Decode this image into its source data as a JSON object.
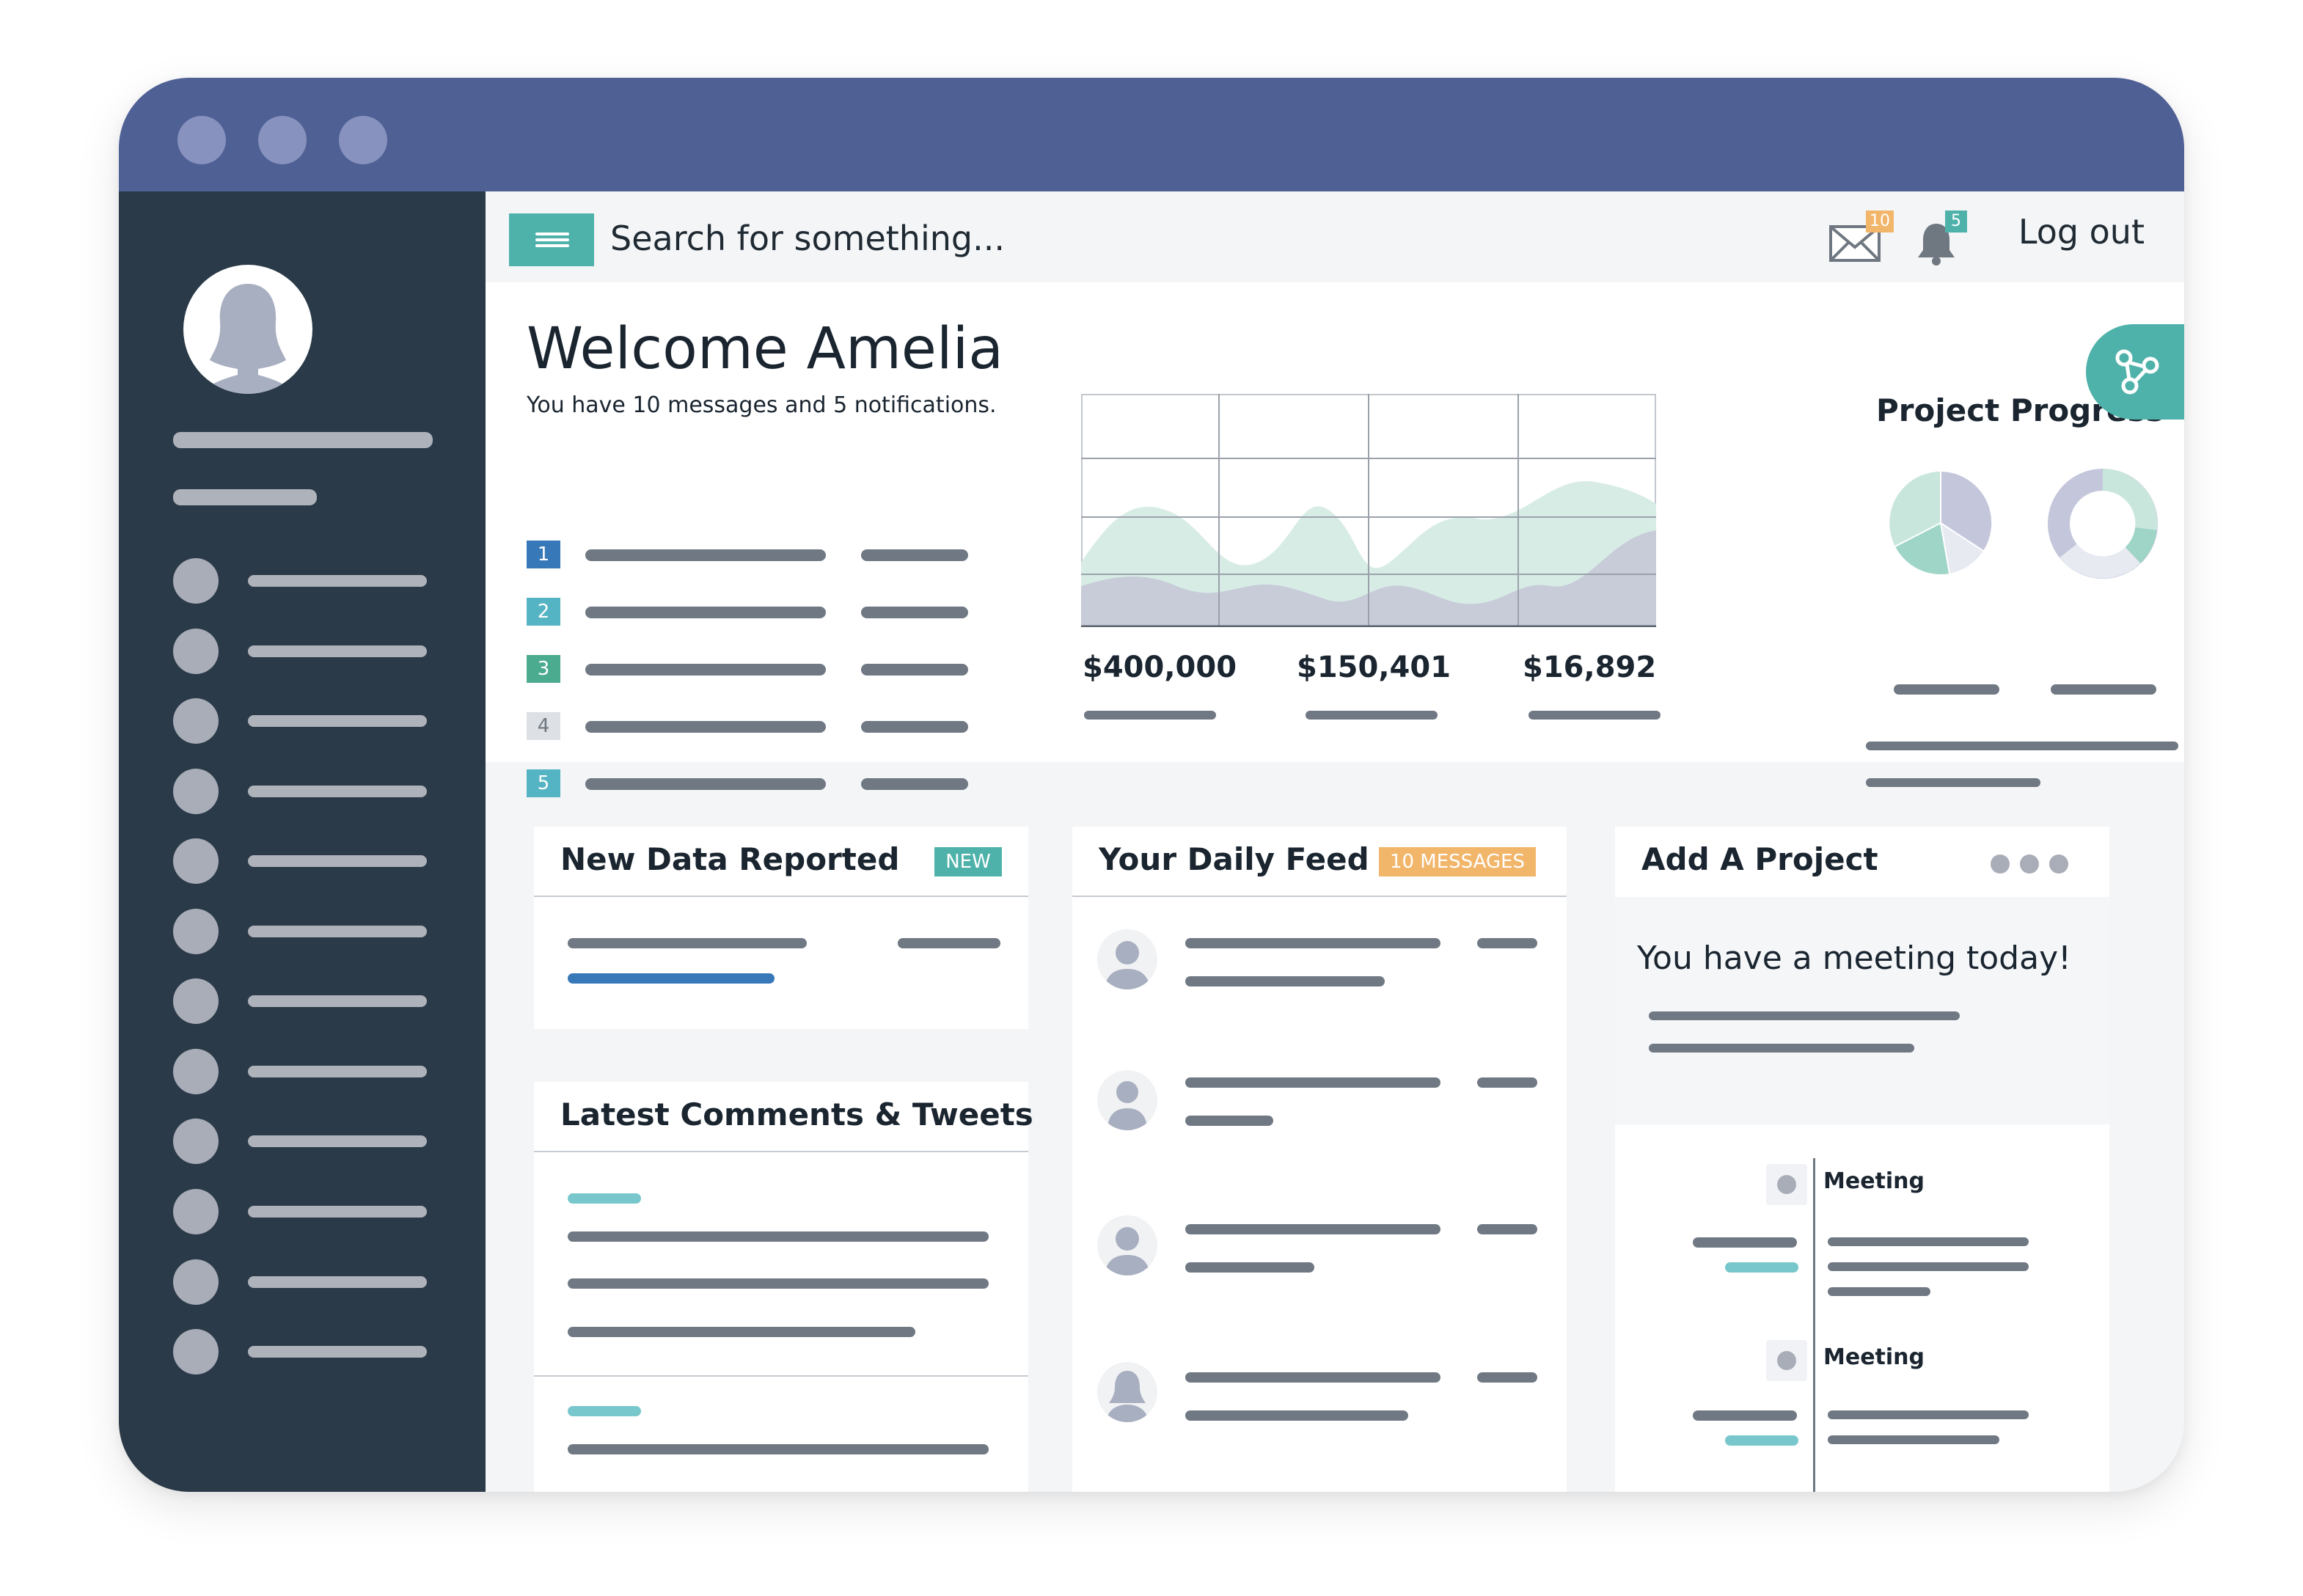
{
  "search": {
    "placeholder": "Search for something..."
  },
  "header": {
    "mail_count": "10",
    "notification_count": "5",
    "logout_label": "Log out",
    "icons": {
      "menu": "hamburger-icon",
      "mail": "envelope-icon",
      "bell": "bell-icon",
      "share": "share-nodes-icon"
    }
  },
  "welcome": {
    "title": "Welcome Amelia",
    "subtitle": "You have 10 messages and 5 notifications.",
    "list": [
      {
        "num": "1",
        "color": "#3778b8"
      },
      {
        "num": "2",
        "color": "#55b4c3"
      },
      {
        "num": "3",
        "color": "#4bab8f"
      },
      {
        "num": "4",
        "color": "#dde0e4"
      },
      {
        "num": "5",
        "color": "#55b4c3"
      }
    ]
  },
  "stats": {
    "values": [
      "$400,000",
      "$150,401",
      "$16,892"
    ]
  },
  "project_progress": {
    "title": "Project Progress"
  },
  "panels": {
    "new_data": {
      "title": "New Data Reported",
      "tag": "NEW",
      "tag_color": "#4fb2aa"
    },
    "comments": {
      "title": "Latest Comments & Tweets"
    },
    "feed": {
      "title": "Your Daily Feed",
      "tag": "10 MESSAGES",
      "tag_color": "#f2b66b"
    },
    "project": {
      "title": "Add A Project",
      "meeting_text": "You have a meeting today!",
      "timeline": [
        "Meeting",
        "Meeting"
      ]
    }
  },
  "colors": {
    "titlebar": "#4f6095",
    "sidebar": "#2b3a48",
    "accent": "#4fb2aa",
    "progress_blue": "#3778b8"
  }
}
